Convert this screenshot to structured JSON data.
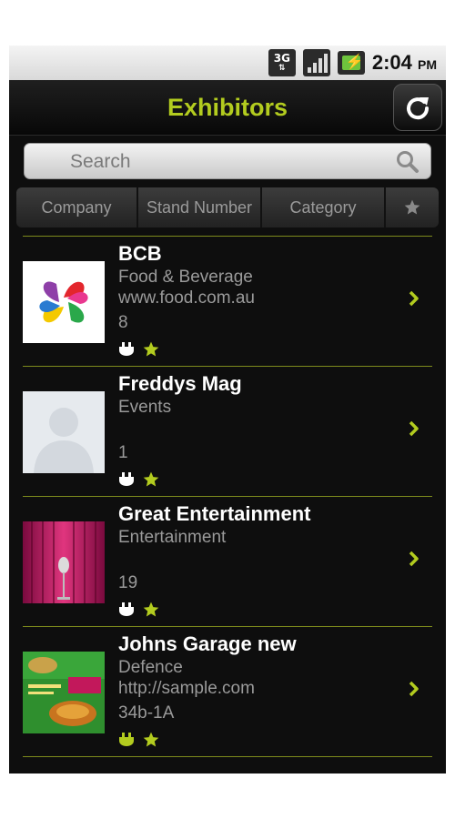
{
  "status_bar": {
    "network": "3G",
    "time": "2:04",
    "ampm": "PM",
    "icons": [
      "3g-icon",
      "signal-icon",
      "battery-icon"
    ]
  },
  "header": {
    "title": "Exhibitors",
    "refresh_icon": "refresh-icon",
    "title_color": "#b3cc1f"
  },
  "search": {
    "placeholder": "Search",
    "value": "",
    "icon": "search-icon"
  },
  "sort_tabs": [
    {
      "label": "Company"
    },
    {
      "label": "Stand Number"
    },
    {
      "label": "Category"
    },
    {
      "label": "",
      "icon": "star-icon"
    }
  ],
  "exhibitors": [
    {
      "name": "BCB",
      "category": "Food & Beverage",
      "url": "www.food.com.au",
      "stand": "8",
      "plug_color": "#ffffff",
      "favorite": true
    },
    {
      "name": "Freddys Mag",
      "category": "Events",
      "url": "",
      "stand": "1",
      "plug_color": "#ffffff",
      "favorite": true
    },
    {
      "name": "Great Entertainment",
      "category": "Entertainment",
      "url": "",
      "stand": "19",
      "plug_color": "#ffffff",
      "favorite": true
    },
    {
      "name": "Johns Garage new",
      "category": "Defence",
      "url": "http://sample.com",
      "stand": "34b-1A",
      "plug_color": "#b3cc1f",
      "favorite": true
    }
  ],
  "colors": {
    "accent": "#b3cc1f",
    "background": "#0e0e0e",
    "divider": "#7d8b1c",
    "secondary_text": "#9a9a9a"
  }
}
